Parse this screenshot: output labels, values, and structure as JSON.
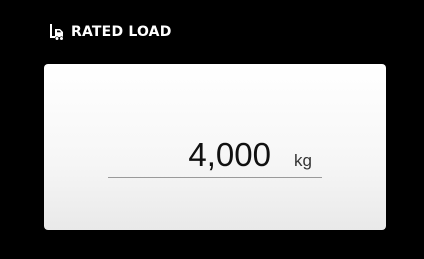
{
  "header": {
    "icon": "forklift-icon",
    "title": "RATED LOAD"
  },
  "rated_load": {
    "value": "4,000",
    "unit": "kg"
  },
  "colors": {
    "background": "#000000",
    "card": "#f5f5f5",
    "text": "#111111",
    "header_text": "#ffffff",
    "underline": "#9a9a9a"
  }
}
